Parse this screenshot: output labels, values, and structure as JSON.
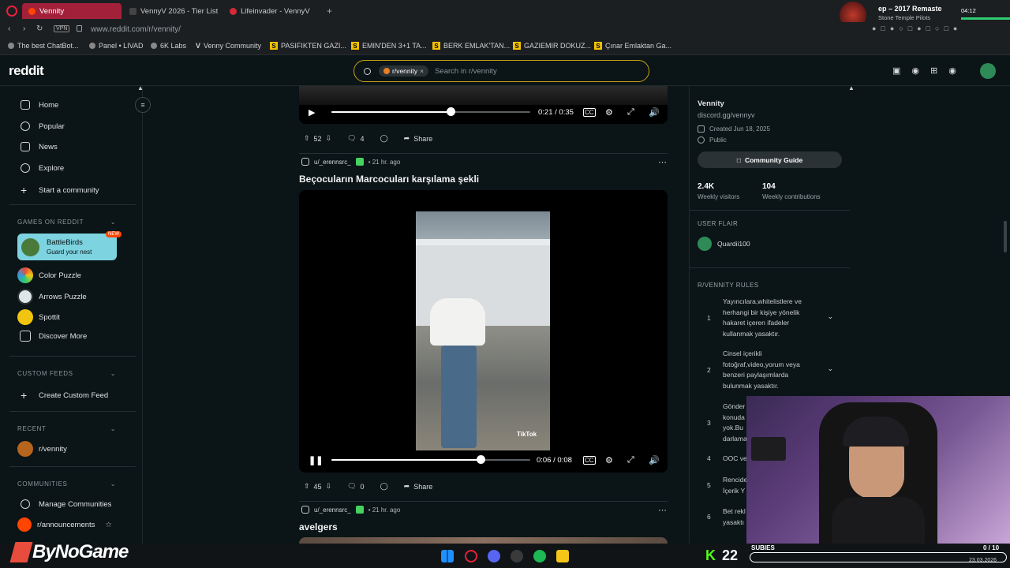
{
  "browser": {
    "tabs": [
      {
        "label": "Vennity",
        "active": true
      },
      {
        "label": "VennyV 2026 - Tier List |",
        "active": false
      },
      {
        "label": "Lifeinvader - VennyV",
        "active": false
      }
    ],
    "url": "www.reddit.com/r/vennity/",
    "vpn_label": "VPN",
    "bookmarks": [
      "The best ChatBot...",
      "Panel • LIVAD",
      "6K Labs",
      "Venny Community",
      "PASIFIKTEN GAZI...",
      "EMIN'DEN 3+1 TA...",
      "BERK EMLAK'TAN...",
      "GAZIEMIR DOKUZ...",
      "Çınar Emlaktan Ga..."
    ],
    "media": {
      "title": "ep – 2017 Remaste",
      "artist": "Stone Temple Pilots",
      "time": "04:12"
    }
  },
  "reddit": {
    "logo": "reddit",
    "search": {
      "chip": "r/vennity",
      "placeholder": "Search in r/vennity"
    }
  },
  "sidebar": {
    "nav": [
      "Home",
      "Popular",
      "News",
      "Explore",
      "Start a community"
    ],
    "games_header": "GAMES ON REDDIT",
    "featured_game": {
      "name": "BattleBirds",
      "subtitle": "Guard your nest",
      "badge": "NEW"
    },
    "games": [
      "Color Puzzle",
      "Arrows Puzzle",
      "Spottit",
      "Discover More"
    ],
    "custom_header": "CUSTOM FEEDS",
    "create_feed": "Create Custom Feed",
    "recent_header": "RECENT",
    "recent": [
      "r/vennity"
    ],
    "communities_header": "COMMUNITIES",
    "communities": [
      "Manage Communities",
      "r/announcements"
    ]
  },
  "feed": {
    "post0": {
      "time": "0:21 / 0:35",
      "progress": 0.6,
      "upvotes": "52",
      "comments": "4",
      "share": "Share"
    },
    "post1": {
      "author": "u/_erennsrc_",
      "age": "• 21 hr. ago",
      "title": "Beçocuların Marcocuları karşılama şekli",
      "video_overlay": "TikTok",
      "time": "0:06 / 0:08",
      "progress": 0.75,
      "upvotes": "45",
      "comments": "0",
      "share": "Share"
    },
    "post2": {
      "author": "u/_erennsrc_",
      "age": "• 21 hr. ago",
      "title": "avelgers"
    }
  },
  "community": {
    "name": "Vennity",
    "link": "discord.gg/vennyv",
    "created": "Created Jun 18, 2025",
    "visibility": "Public",
    "guide_button": "Community Guide",
    "stats": [
      {
        "value": "2.4K",
        "label": "Weekly visitors"
      },
      {
        "value": "104",
        "label": "Weekly contributions"
      }
    ],
    "flair_header": "USER FLAIR",
    "flair_user": "Quardii100",
    "rules_header": "R/VENNITY RULES",
    "rules": [
      {
        "num": "1",
        "text": "Yayıncılara,whitelistlere ve herhangi bir kişiye yönelik hakaret içeren ifadeler kullanmak yasaktır."
      },
      {
        "num": "2",
        "text": "Cinsel içerikli fotoğraf,video,yorum veya benzeri paylaşımlarda bulunmak yasaktır."
      },
      {
        "num": "3",
        "text": "Gönder konuda yok.Bu darlama"
      },
      {
        "num": "4",
        "text": "OOC ve"
      },
      {
        "num": "5",
        "text": "Rencide İçerik Y"
      },
      {
        "num": "6",
        "text": "Bet rekl yasaktı"
      }
    ]
  },
  "overlay": {
    "brand": "ByNoGame",
    "kick_count": "22",
    "subs_label": "SUBIES",
    "sub_progress": "0 / 10",
    "date": "23.03.2026"
  }
}
